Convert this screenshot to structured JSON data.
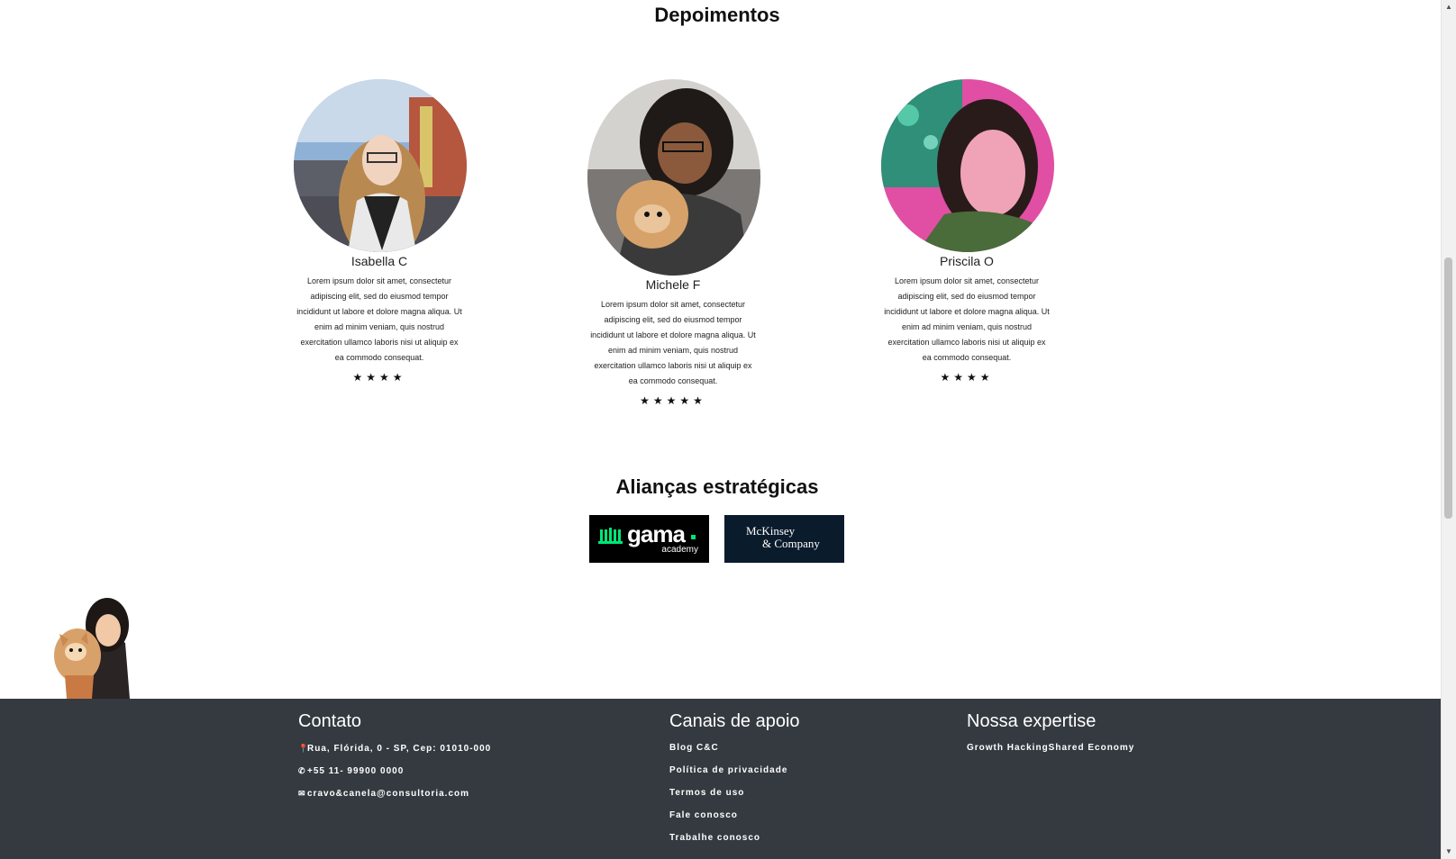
{
  "testimonials": {
    "title": "Depoimentos",
    "items": [
      {
        "name": "Isabella C",
        "text": "Lorem ipsum dolor sit amet, consectetur adipiscing elit, sed do eiusmod tempor incididunt ut labore et dolore magna aliqua. Ut enim ad minim veniam, quis nostrud exercitation ullamco laboris nisi ut aliquip ex ea commodo consequat.",
        "stars": "★★★★",
        "rating": 4
      },
      {
        "name": "Michele F",
        "text": "Lorem ipsum dolor sit amet, consectetur adipiscing elit, sed do eiusmod tempor incididunt ut labore et dolore magna aliqua. Ut enim ad minim veniam, quis nostrud exercitation ullamco laboris nisi ut aliquip ex ea commodo consequat.",
        "stars": "★★★★★",
        "rating": 5
      },
      {
        "name": "Priscila O",
        "text": "Lorem ipsum dolor sit amet, consectetur adipiscing elit, sed do eiusmod tempor incididunt ut labore et dolore magna aliqua. Ut enim ad minim veniam, quis nostrud exercitation ullamco laboris nisi ut aliquip ex ea commodo consequat.",
        "stars": "★★★★",
        "rating": 4
      }
    ]
  },
  "alliances": {
    "title": "Alianças estratégicas",
    "logos": [
      {
        "name": "gama",
        "subtext": "academy"
      },
      {
        "line1": "McKinsey",
        "line2": "& Company"
      }
    ]
  },
  "footer": {
    "contact": {
      "heading": "Contato",
      "address": "Rua, Flórida, 0 - SP, Cep: 01010-000",
      "phone": "+55 11- 99900 0000",
      "email": "cravo&canela@consultoria.com"
    },
    "support": {
      "heading": "Canais de apoio",
      "links": [
        "Blog C&C",
        "Política de privacidade",
        "Termos de uso",
        "Fale conosco",
        "Trabalhe conosco"
      ]
    },
    "expertise": {
      "heading": "Nossa expertise",
      "text": "Growth HackingShared Economy"
    }
  },
  "colors": {
    "footer_bg": "#343a40",
    "gama_accent": "#00e676",
    "mckinsey_bg": "#0a1b2c"
  },
  "icons": {
    "address": "map-pin-icon",
    "phone": "phone-icon",
    "email": "envelope-icon"
  }
}
